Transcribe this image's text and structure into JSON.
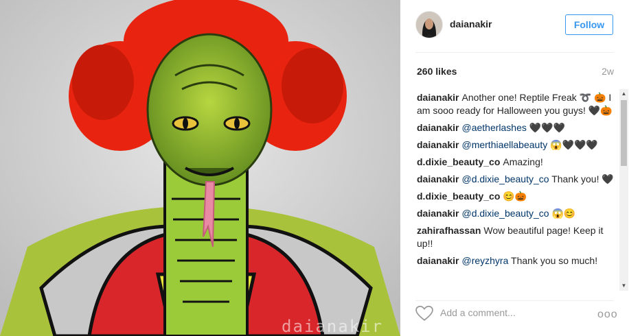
{
  "post": {
    "watermark": "daianakir"
  },
  "header": {
    "username": "daianakir",
    "follow_label": "Follow"
  },
  "meta": {
    "likes": "260 likes",
    "ago": "2w"
  },
  "comments": [
    {
      "user": "daianakir",
      "parts": [
        {
          "t": "Another one! Reptile Freak ➰ 🎃 I am sooo ready for Halloween you guys! 🖤🎃",
          "m": false
        }
      ]
    },
    {
      "user": "daianakir",
      "parts": [
        {
          "t": "@aetherlashes",
          "m": true
        },
        {
          "t": " 🖤🖤🖤",
          "m": false
        }
      ]
    },
    {
      "user": "daianakir",
      "parts": [
        {
          "t": "@merthiaellabeauty",
          "m": true
        },
        {
          "t": " 😱🖤🖤🖤",
          "m": false
        }
      ]
    },
    {
      "user": "d.dixie_beauty_co",
      "parts": [
        {
          "t": "Amazing!",
          "m": false
        }
      ]
    },
    {
      "user": "daianakir",
      "parts": [
        {
          "t": "@d.dixie_beauty_co",
          "m": true
        },
        {
          "t": " Thank you! 🖤",
          "m": false
        }
      ]
    },
    {
      "user": "d.dixie_beauty_co",
      "parts": [
        {
          "t": "😊🎃",
          "m": false
        }
      ]
    },
    {
      "user": "daianakir",
      "parts": [
        {
          "t": "@d.dixie_beauty_co",
          "m": true
        },
        {
          "t": " 😱😊",
          "m": false
        }
      ]
    },
    {
      "user": "zahirafhassan",
      "parts": [
        {
          "t": "Wow beautiful page! Keep it up!!",
          "m": false
        }
      ]
    },
    {
      "user": "daianakir",
      "parts": [
        {
          "t": "@reyzhyra",
          "m": true
        },
        {
          "t": " Thank you so much!",
          "m": false
        }
      ]
    }
  ],
  "add_comment": {
    "placeholder": "Add a comment...",
    "more_label": "ooo"
  },
  "icons": {
    "like": "heart-icon",
    "more": "more-options-icon",
    "scroll_up": "scroll-up-icon",
    "scroll_down": "scroll-down-icon"
  },
  "colors": {
    "accent": "#3897f0",
    "mention": "#003569",
    "muted": "#999999"
  }
}
